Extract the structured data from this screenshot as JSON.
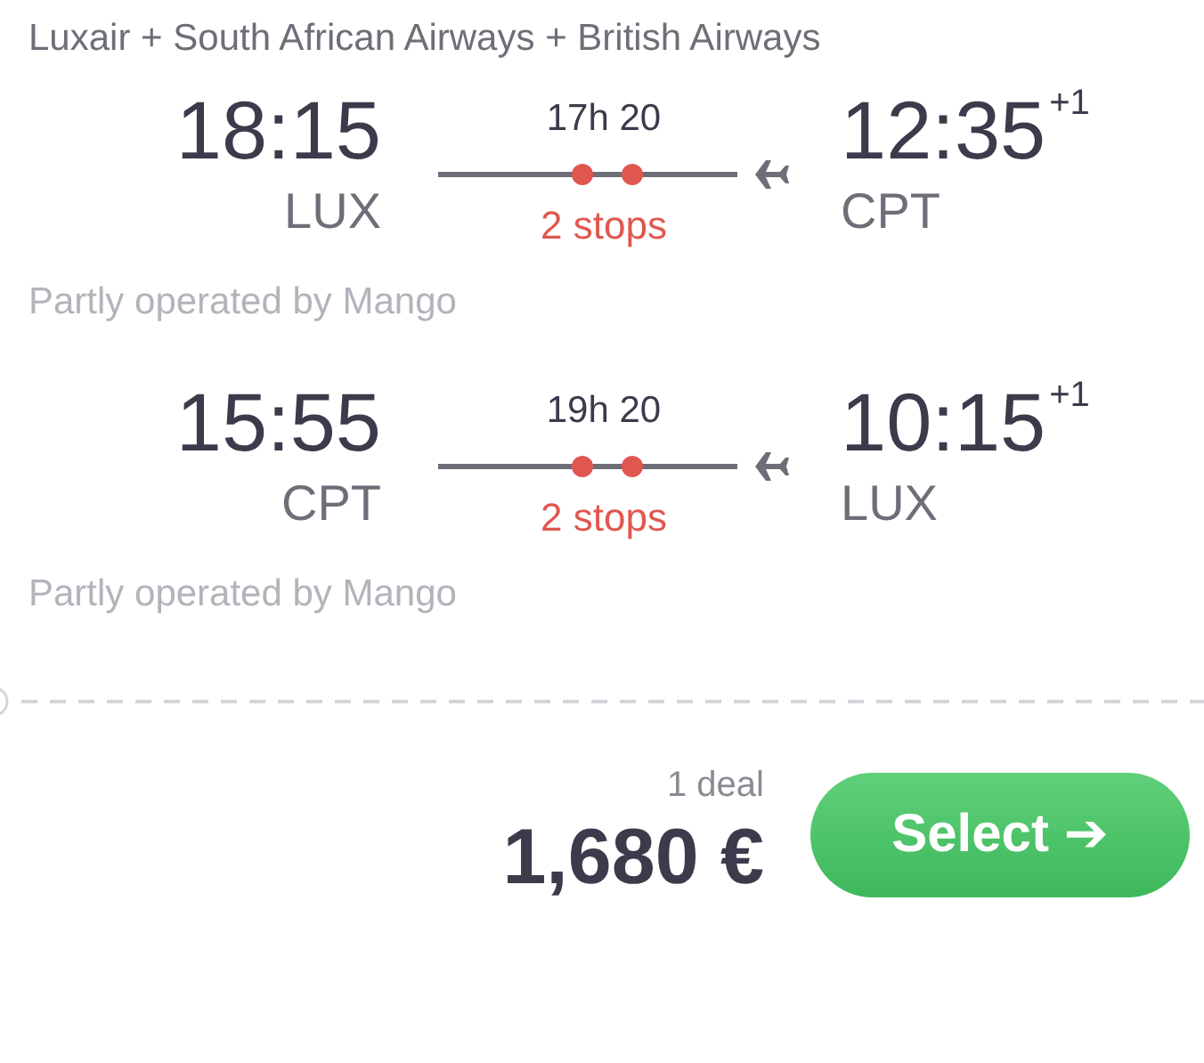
{
  "carriers": "Luxair + South African Airways + British Airways",
  "legs": [
    {
      "departure_time": "18:15",
      "departure_airport": "LUX",
      "duration": "17h 20",
      "stops": "2 stops",
      "arrival_time": "12:35",
      "day_offset": "+1",
      "arrival_airport": "CPT",
      "note": "Partly operated by Mango"
    },
    {
      "departure_time": "15:55",
      "departure_airport": "CPT",
      "duration": "19h 20",
      "stops": "2 stops",
      "arrival_time": "10:15",
      "day_offset": "+1",
      "arrival_airport": "LUX",
      "note": "Partly operated by Mango"
    }
  ],
  "deals": "1 deal",
  "price": "1,680 €",
  "select_button": "Select ➔"
}
